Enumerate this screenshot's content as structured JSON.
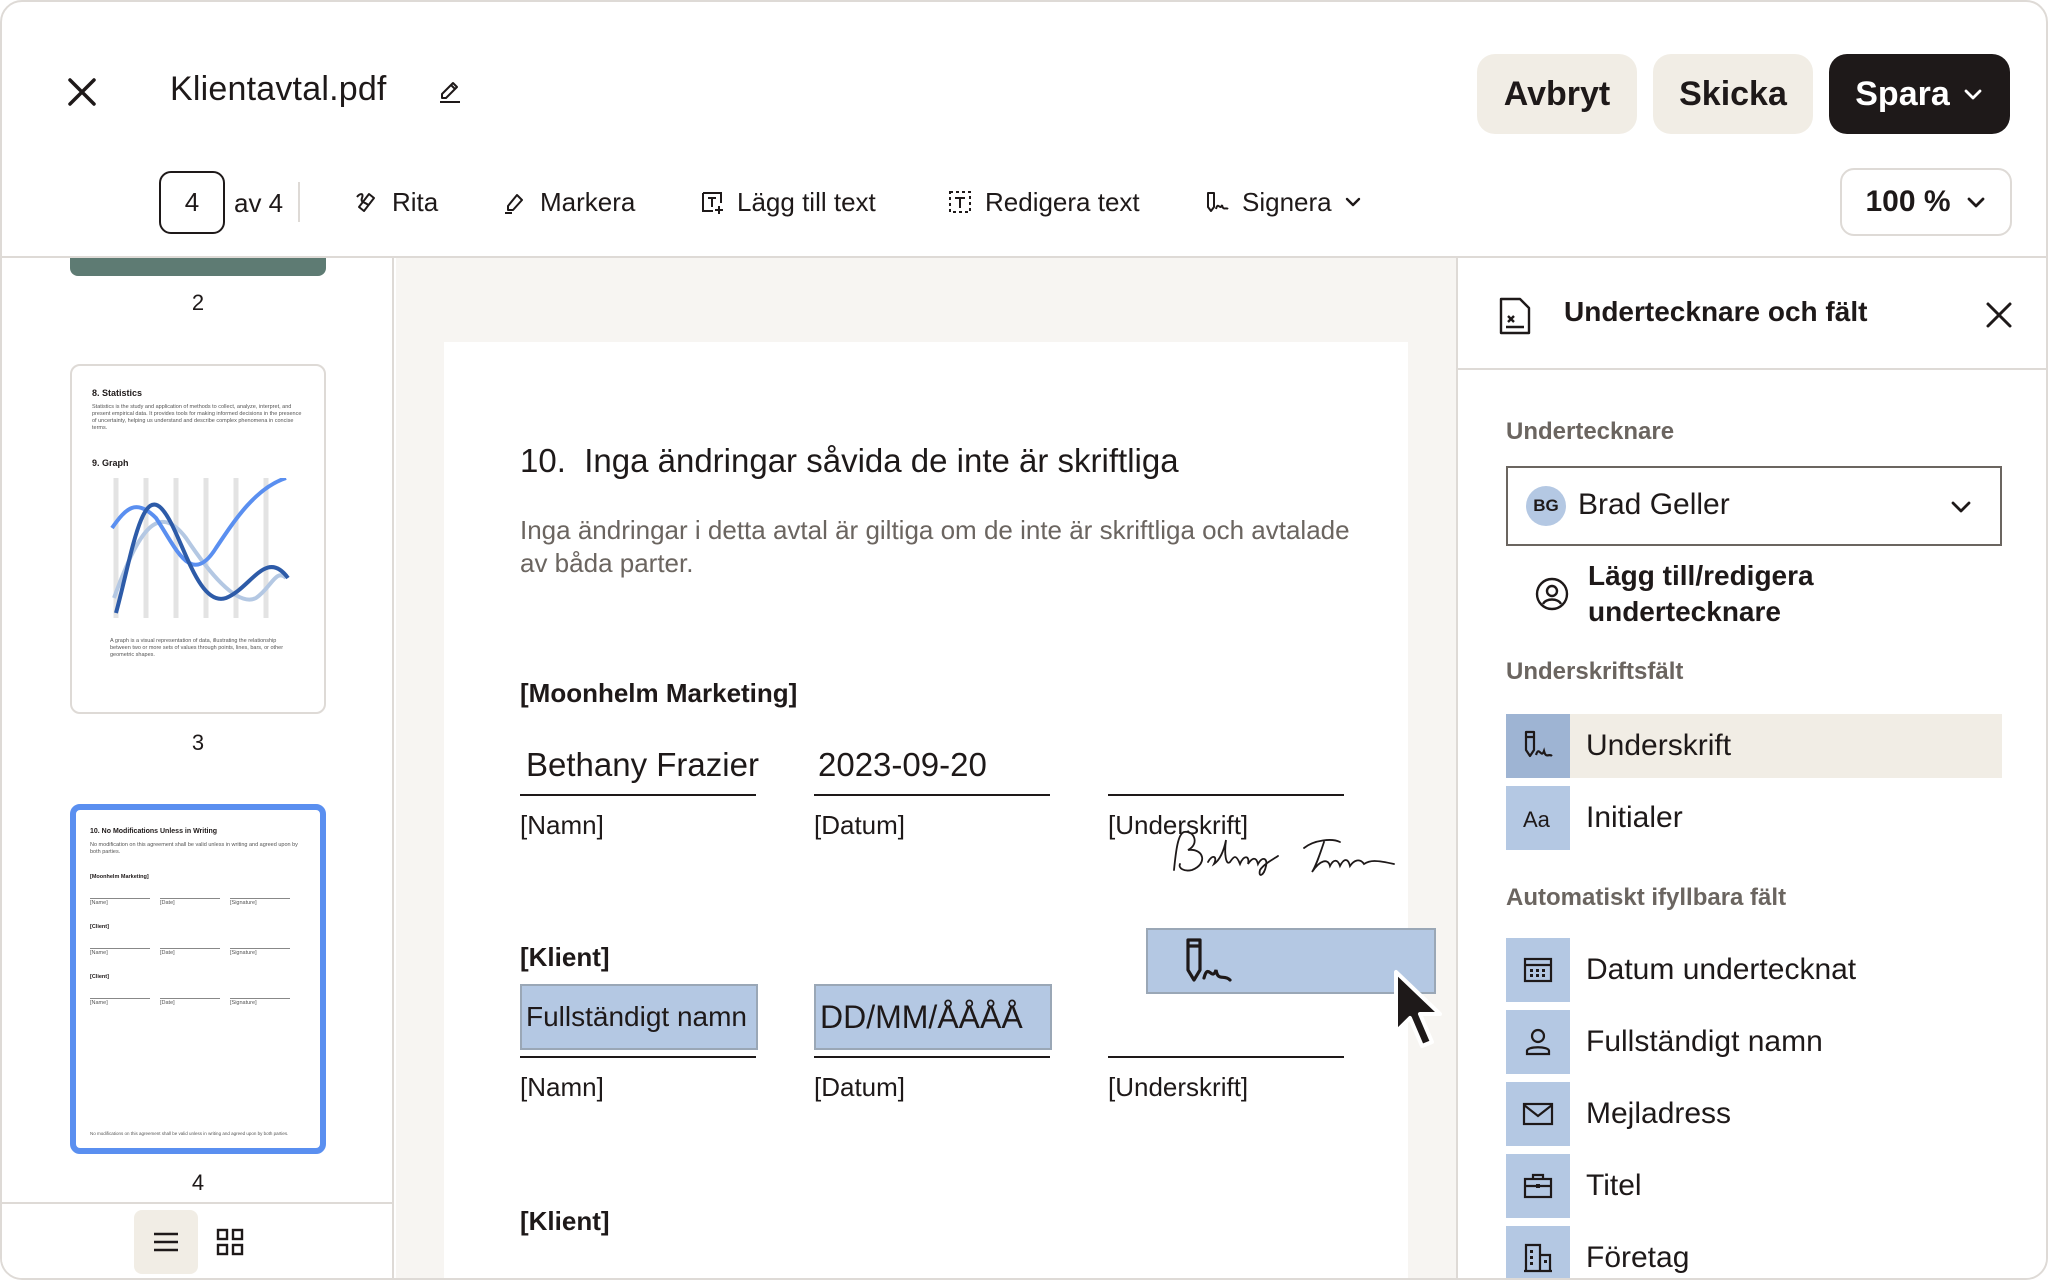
{
  "header": {
    "file_name": "Klientavtal.pdf",
    "cancel_label": "Avbryt",
    "send_label": "Skicka",
    "save_label": "Spara"
  },
  "toolbar": {
    "current_page": "4",
    "page_of": "av 4",
    "tools": [
      {
        "label": "Rita",
        "icon": "draw-icon"
      },
      {
        "label": "Markera",
        "icon": "highlight-icon"
      },
      {
        "label": "Lägg till text",
        "icon": "add-text-icon"
      },
      {
        "label": "Redigera text",
        "icon": "edit-text-icon"
      },
      {
        "label": "Signera",
        "icon": "sign-icon"
      }
    ],
    "zoom": "100 %"
  },
  "thumbnails": {
    "pages": [
      {
        "number": "2"
      },
      {
        "number": "3",
        "heading1": "8. Statistics",
        "text1": "Statistics is the study and application of methods to collect, analyze, interpret, and present empirical data. It provides tools for making informed decisions in the presence of uncertainty, helping us understand and describe complex phenomena in concise terms.",
        "heading2": "9. Graph",
        "text2": "A graph is a visual representation of data, illustrating the relationship between two or more sets of values through points, lines, bars, or other geometric shapes."
      },
      {
        "number": "4",
        "heading": "10. No Modifications Unless in Writing",
        "text": "No modification on this agreement shall be valid unless in writing and agreed upon by both parties.",
        "party1": "[Moonhelm Marketing]",
        "party2": "[Client]",
        "party3": "[Client]",
        "lbl_name": "[Name]",
        "lbl_date": "[Date]",
        "lbl_sig": "[Signature]",
        "footer": "No modifications on this agreement shall be valid unless in writing and agreed upon by both parties."
      }
    ]
  },
  "document": {
    "section_number": "10.",
    "section_title": "Inga ändringar såvida de inte är skriftliga",
    "section_body": "Inga ändringar i detta avtal är giltiga om de inte är skriftliga och avtalade av båda parter.",
    "party1": "[Moonhelm Marketing]",
    "party1_name": "Bethany Frazier",
    "party1_date": "2023-09-20",
    "party2": "[Klient]",
    "party2_name_placeholder": "Fullständigt namn",
    "party2_date_placeholder": "DD/MM/ÅÅÅÅ",
    "party3": "[Klient]",
    "label_name": "[Namn]",
    "label_date": "[Datum]",
    "label_signature": "[Underskrift]"
  },
  "right_panel": {
    "title": "Undertecknare och fält",
    "signers_heading": "Undertecknare",
    "signer_initials": "BG",
    "signer_name": "Brad Geller",
    "add_signer": "Lägg till/redigera undertecknare",
    "signature_fields_heading": "Underskriftsfält",
    "signature_fields": [
      {
        "label": "Underskrift",
        "icon": "signature-icon",
        "selected": true
      },
      {
        "label": "Initialer",
        "icon": "initials-icon",
        "selected": false
      }
    ],
    "auto_fields_heading": "Automatiskt ifyllbara fält",
    "auto_fields": [
      {
        "label": "Datum undertecknat",
        "icon": "calendar-icon"
      },
      {
        "label": "Fullständigt namn",
        "icon": "person-icon"
      },
      {
        "label": "Mejladress",
        "icon": "mail-icon"
      },
      {
        "label": "Titel",
        "icon": "briefcase-icon"
      },
      {
        "label": "Företag",
        "icon": "building-icon"
      }
    ]
  },
  "colors": {
    "accent_field": "#b4c8e3",
    "dark_button": "#1e1919",
    "light_button": "#f1ede5",
    "selected_thumb": "#5a8ff0"
  }
}
